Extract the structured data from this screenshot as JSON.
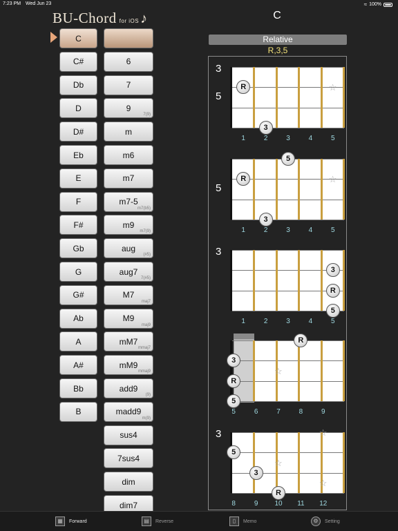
{
  "status": {
    "time": "7:23 PM",
    "date": "Wed Jun 23",
    "battery": "100%"
  },
  "app": {
    "logo": "BU-Chord",
    "logo_sub": "for iOS",
    "logo_note": "♪"
  },
  "chord": {
    "name": "C",
    "mode_label": "Relative",
    "formula": "R,3,5"
  },
  "roots": [
    "C",
    "C#",
    "Db",
    "D",
    "D#",
    "Eb",
    "E",
    "F",
    "F#",
    "Gb",
    "G",
    "G#",
    "Ab",
    "A",
    "A#",
    "Bb",
    "B"
  ],
  "selected_root": "C",
  "qualities": [
    {
      "label": "",
      "sub": ""
    },
    {
      "label": "6",
      "sub": ""
    },
    {
      "label": "7",
      "sub": ""
    },
    {
      "label": "9",
      "sub": "7(9)"
    },
    {
      "label": "m",
      "sub": ""
    },
    {
      "label": "m6",
      "sub": ""
    },
    {
      "label": "m7",
      "sub": ""
    },
    {
      "label": "m7-5",
      "sub": "m7(b5)"
    },
    {
      "label": "m9",
      "sub": "m7(9)"
    },
    {
      "label": "aug",
      "sub": "(#5)"
    },
    {
      "label": "aug7",
      "sub": "7(#5)"
    },
    {
      "label": "M7",
      "sub": "maj7"
    },
    {
      "label": "M9",
      "sub": "maj9"
    },
    {
      "label": "mM7",
      "sub": "mmaj7"
    },
    {
      "label": "mM9",
      "sub": "mmaj9"
    },
    {
      "label": "add9",
      "sub": "(9)"
    },
    {
      "label": "madd9",
      "sub": "m(9)"
    },
    {
      "label": "sus4",
      "sub": ""
    },
    {
      "label": "7sus4",
      "sub": ""
    },
    {
      "label": "dim",
      "sub": ""
    },
    {
      "label": "dim7",
      "sub": ""
    }
  ],
  "diagrams": [
    {
      "frets": [
        "1",
        "2",
        "3",
        "4",
        "5"
      ],
      "side": {
        "top": "3",
        "mid": "5"
      },
      "marks": [
        {
          "string": 2,
          "fret": 1,
          "label": "R"
        },
        {
          "string": 4,
          "fret": 2,
          "label": "3"
        },
        {
          "string": 2,
          "fret": 5,
          "label": "☆"
        }
      ]
    },
    {
      "frets": [
        "1",
        "2",
        "3",
        "4",
        "5"
      ],
      "side": {
        "top": "",
        "mid": "5"
      },
      "marks": [
        {
          "string": 1,
          "fret": 3,
          "label": "5"
        },
        {
          "string": 2,
          "fret": 1,
          "label": "R"
        },
        {
          "string": 4,
          "fret": 2,
          "label": "3"
        },
        {
          "string": 2,
          "fret": 5,
          "label": "☆"
        }
      ]
    },
    {
      "frets": [
        "1",
        "2",
        "3",
        "4",
        "5"
      ],
      "side": {
        "top": "3",
        "mid": ""
      },
      "marks": [
        {
          "string": 2,
          "fret": 5,
          "label": "3"
        },
        {
          "string": 3,
          "fret": 5,
          "label": "R"
        },
        {
          "string": 4,
          "fret": 5,
          "label": "5"
        }
      ]
    },
    {
      "frets": [
        "5",
        "6",
        "7",
        "8",
        "9"
      ],
      "side": {
        "top": "",
        "mid": ""
      },
      "selected_fret": "5",
      "marks": [
        {
          "string": 1,
          "fret": 4,
          "label": "R"
        },
        {
          "string": 2,
          "fret": 1,
          "label": "3"
        },
        {
          "string": 3,
          "fret": 1,
          "label": "R"
        },
        {
          "string": 4,
          "fret": 1,
          "label": "5"
        },
        {
          "string": 2.5,
          "fret": 3,
          "label": "☆"
        }
      ]
    },
    {
      "frets": [
        "8",
        "9",
        "10",
        "11",
        "12"
      ],
      "side": {
        "top": "3",
        "mid": ""
      },
      "marks": [
        {
          "string": 2,
          "fret": 1,
          "label": "5"
        },
        {
          "string": 3,
          "fret": 2,
          "label": "3"
        },
        {
          "string": 4,
          "fret": 3,
          "label": "R"
        },
        {
          "string": 1,
          "fret": 5,
          "label": "☆"
        },
        {
          "string": 2.5,
          "fret": 3,
          "label": "☆"
        },
        {
          "string": 3.5,
          "fret": 5,
          "label": "☆"
        }
      ]
    }
  ],
  "tabs": [
    {
      "label": "Forward",
      "icon": "forward-icon",
      "active": true
    },
    {
      "label": "Reverse",
      "icon": "reverse-icon",
      "active": false
    },
    {
      "label": "Memo",
      "icon": "memo-icon",
      "active": false
    },
    {
      "label": "Setting",
      "icon": "gear-icon",
      "active": false
    }
  ]
}
